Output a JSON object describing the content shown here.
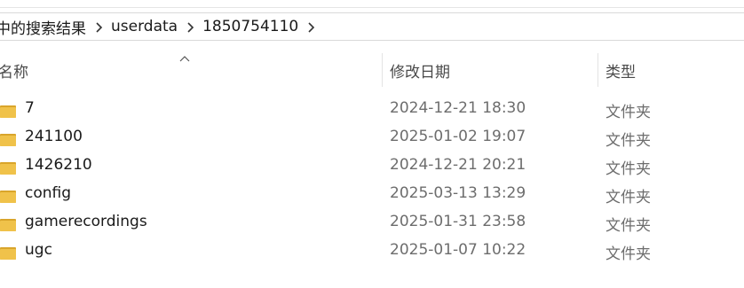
{
  "breadcrumb": {
    "items": [
      {
        "label": "中的搜索结果"
      },
      {
        "label": "userdata"
      },
      {
        "label": "1850754110"
      }
    ]
  },
  "columns": {
    "name": "名称",
    "date_modified": "修改日期",
    "type": "类型",
    "sorted_by": "name"
  },
  "files": [
    {
      "name": "7",
      "date": "2024-12-21 18:30",
      "type": "文件夹",
      "icon": "folder-icon"
    },
    {
      "name": "241100",
      "date": "2025-01-02 19:07",
      "type": "文件夹",
      "icon": "folder-icon"
    },
    {
      "name": "1426210",
      "date": "2024-12-21 20:21",
      "type": "文件夹",
      "icon": "folder-icon"
    },
    {
      "name": "config",
      "date": "2025-03-13 13:29",
      "type": "文件夹",
      "icon": "folder-icon"
    },
    {
      "name": "gamerecordings",
      "date": "2025-01-31 23:58",
      "type": "文件夹",
      "icon": "folder-icon"
    },
    {
      "name": "ugc",
      "date": "2025-01-07 10:22",
      "type": "文件夹",
      "icon": "folder-icon"
    }
  ],
  "colors": {
    "folder": "#f0c24a",
    "folder_dark": "#d9a52b",
    "text": "#1a1a1a",
    "muted_text": "#6d6d6d"
  }
}
